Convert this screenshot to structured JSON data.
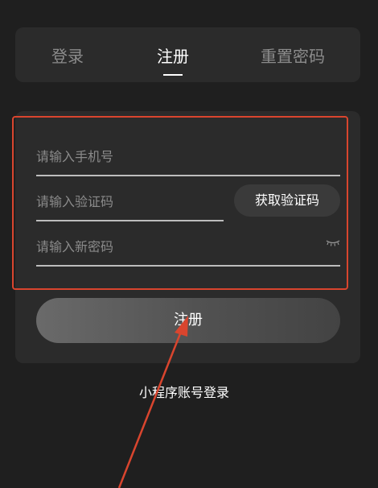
{
  "tabs": {
    "login": "登录",
    "register": "注册",
    "reset_password": "重置密码"
  },
  "form": {
    "phone_placeholder": "请输入手机号",
    "code_placeholder": "请输入验证码",
    "get_code_label": "获取验证码",
    "new_password_placeholder": "请输入新密码"
  },
  "submit_label": "注册",
  "mini_program_login_label": "小程序账号登录",
  "colors": {
    "background": "#1f1f1f",
    "card": "#2b2b2b",
    "annotation": "#d9452e"
  }
}
